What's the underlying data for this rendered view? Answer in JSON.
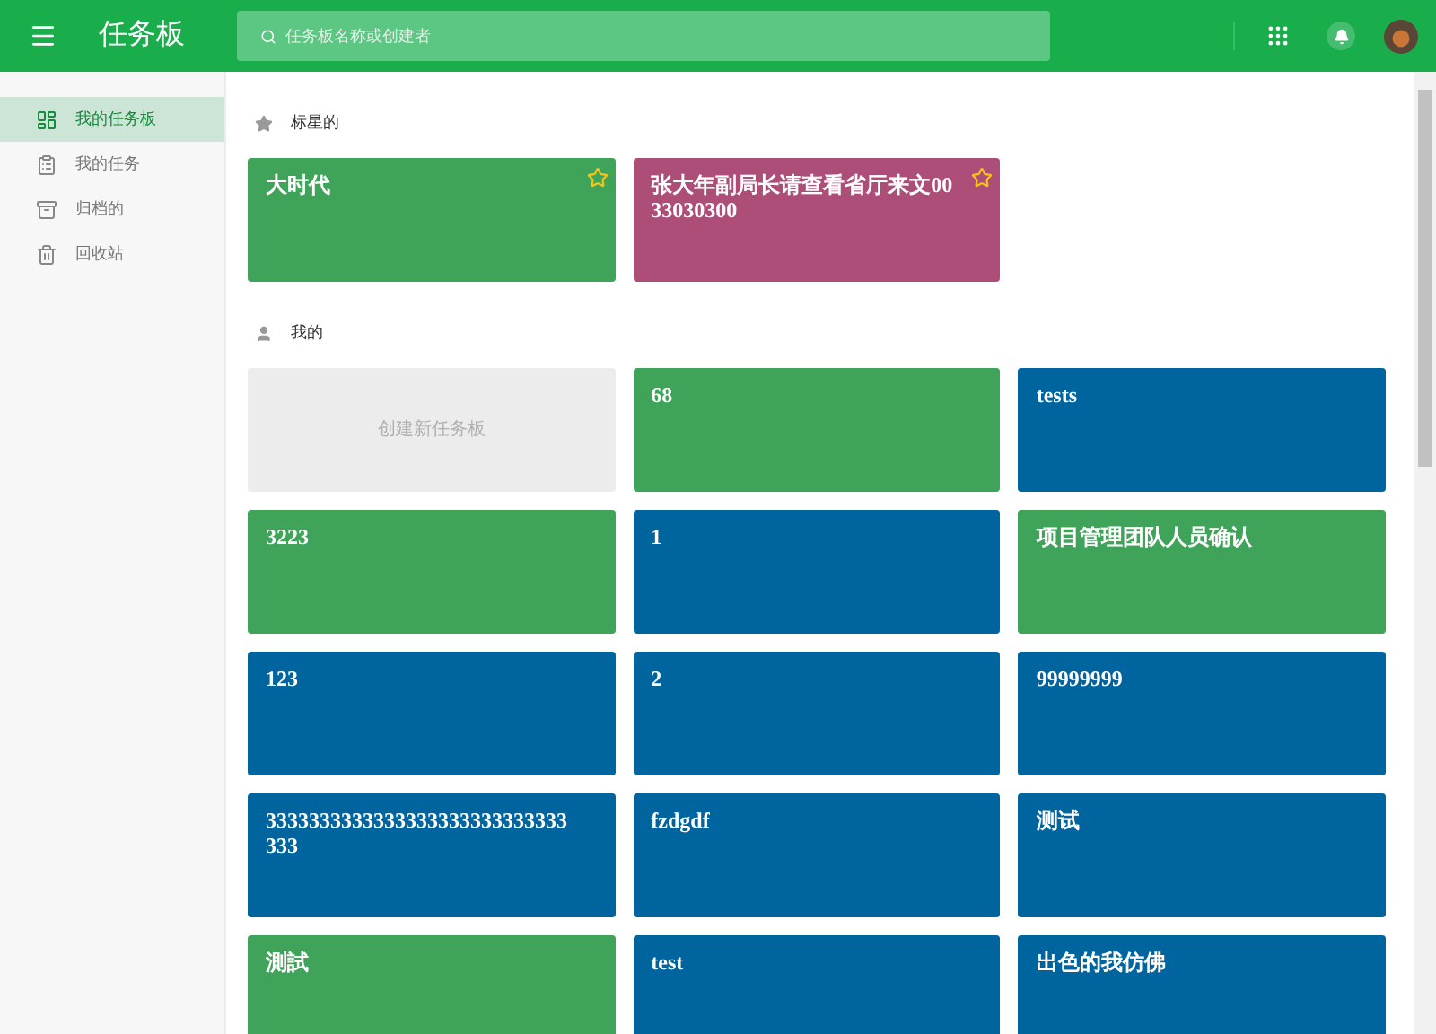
{
  "header": {
    "title": "任务板",
    "search": {
      "placeholder": "任务板名称或创建者"
    }
  },
  "sidebar": {
    "items": [
      {
        "label": "我的任务板",
        "selected": true
      },
      {
        "label": "我的任务",
        "selected": false
      },
      {
        "label": "归档的",
        "selected": false
      },
      {
        "label": "回收站",
        "selected": false
      }
    ]
  },
  "sections": [
    {
      "title": "标星的",
      "boards": [
        {
          "kind": "board",
          "title": "大时代",
          "color": "#40a35a",
          "starred": true
        },
        {
          "kind": "board",
          "title": "张大年副局长请查看省厅来文0033030300",
          "color": "#ad4e79",
          "starred": true
        }
      ]
    },
    {
      "title": "我的",
      "boards": [
        {
          "kind": "create",
          "title": "创建新任务板"
        },
        {
          "kind": "board",
          "title": "68",
          "color": "#40a35a",
          "starred": false
        },
        {
          "kind": "board",
          "title": "tests",
          "color": "#00659f",
          "starred": false
        },
        {
          "kind": "board",
          "title": "3223",
          "color": "#40a35a",
          "starred": false
        },
        {
          "kind": "board",
          "title": "1",
          "color": "#00659f",
          "starred": false
        },
        {
          "kind": "board",
          "title": "项目管理团队人员确认",
          "color": "#40a35a",
          "starred": false
        },
        {
          "kind": "board",
          "title": "123",
          "color": "#00659f",
          "starred": false
        },
        {
          "kind": "board",
          "title": "2",
          "color": "#00659f",
          "starred": false
        },
        {
          "kind": "board",
          "title": "99999999",
          "color": "#00659f",
          "starred": false
        },
        {
          "kind": "board",
          "title": "3333333333333333333333333333333",
          "color": "#00659f",
          "starred": false
        },
        {
          "kind": "board",
          "title": "fzdgdf",
          "color": "#00659f",
          "starred": false
        },
        {
          "kind": "board",
          "title": "测试",
          "color": "#00659f",
          "starred": false
        },
        {
          "kind": "board",
          "title": "測試",
          "color": "#40a35a",
          "starred": false
        },
        {
          "kind": "board",
          "title": "test",
          "color": "#00659f",
          "starred": false
        },
        {
          "kind": "board",
          "title": "出色的我仿佛",
          "color": "#00659f",
          "starred": false
        }
      ]
    }
  ]
}
